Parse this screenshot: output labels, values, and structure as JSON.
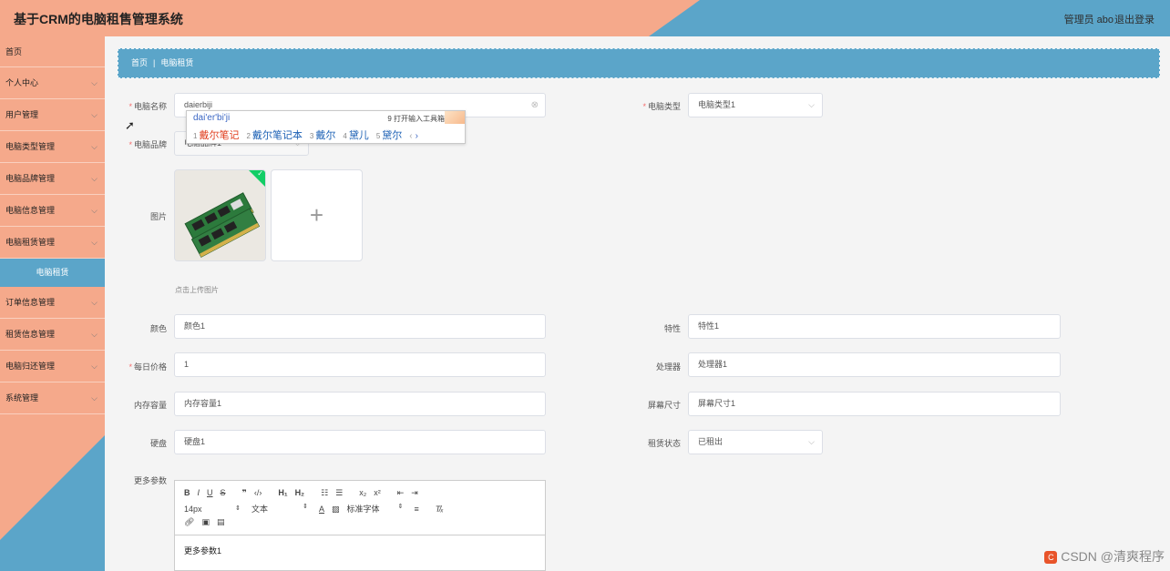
{
  "header": {
    "title": "基于CRM的电脑租售管理系统",
    "admin_label": "管理员 abo",
    "logout_label": "退出登录"
  },
  "sidebar": {
    "items": [
      {
        "label": "首页"
      },
      {
        "label": "个人中心"
      },
      {
        "label": "用户管理"
      },
      {
        "label": "电脑类型管理"
      },
      {
        "label": "电脑品牌管理"
      },
      {
        "label": "电脑信息管理"
      },
      {
        "label": "电脑租赁管理"
      },
      {
        "label": "订单信息管理"
      },
      {
        "label": "租赁信息管理"
      },
      {
        "label": "电脑归还管理"
      },
      {
        "label": "系统管理"
      }
    ],
    "active_sub_item": "电脑租赁"
  },
  "breadcrumb": {
    "home": "首页",
    "current": "电脑租赁"
  },
  "form": {
    "computer_name": {
      "label": "电脑名称",
      "value": "daierbiji"
    },
    "computer_type": {
      "label": "电脑类型",
      "value": "电脑类型1"
    },
    "computer_brand": {
      "label": "电脑品牌",
      "value": "电脑品牌1"
    },
    "image": {
      "label": "图片",
      "upload_hint": "点击上传图片",
      "add_symbol": "+"
    },
    "color": {
      "label": "颜色",
      "value": "颜色1"
    },
    "feature": {
      "label": "特性",
      "value": "特性1"
    },
    "daily_price": {
      "label": "每日价格",
      "value": "1"
    },
    "processor": {
      "label": "处理器",
      "value": "处理器1"
    },
    "memory": {
      "label": "内存容量",
      "value": "内存容量1"
    },
    "screen": {
      "label": "屏幕尺寸",
      "value": "屏幕尺寸1"
    },
    "disk": {
      "label": "硬盘",
      "value": "硬盘1"
    },
    "rent_status": {
      "label": "租赁状态",
      "value": "已租出"
    },
    "more_params": {
      "label": "更多参数",
      "value": "更多参数1"
    }
  },
  "editor": {
    "font_size": "14px",
    "text_type": "文本",
    "font_family": "标准字体"
  },
  "ime": {
    "composition": "dai'er'bi'ji",
    "toolbar_hint": "9 打开输入工具箱",
    "candidates": [
      {
        "num": "1",
        "text": "戴尔笔记"
      },
      {
        "num": "2",
        "text": "戴尔笔记本"
      },
      {
        "num": "3",
        "text": "戴尔"
      },
      {
        "num": "4",
        "text": "黛儿"
      },
      {
        "num": "5",
        "text": "黛尔"
      }
    ],
    "prev": "‹",
    "next": "›"
  },
  "watermark": "CSDN @清爽程序"
}
